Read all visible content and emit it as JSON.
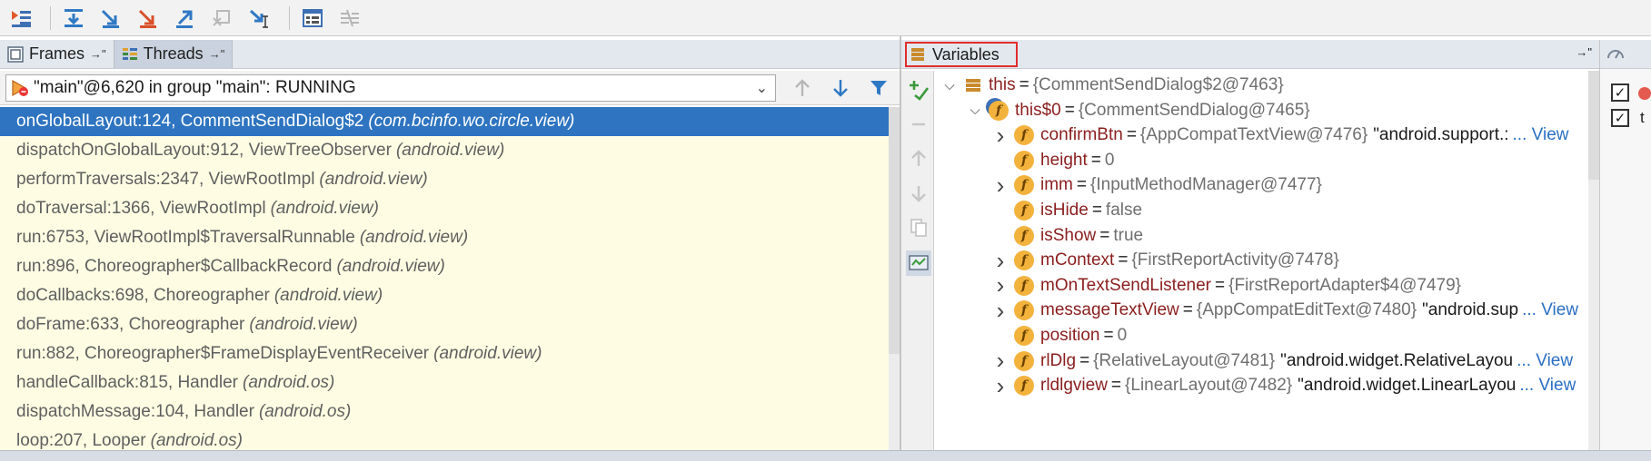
{
  "colors": {
    "selected_row": "#2e74c0",
    "frames_bg": "#fefde3",
    "field_name": "#8b1e1e",
    "type_text": "#6f6f6f",
    "link": "#2a6fc4",
    "highlight_box": "#e22d2d"
  },
  "toolbar": {
    "icons": [
      "show-execution-point-icon",
      "step-over-icon",
      "step-into-icon",
      "force-step-into-icon",
      "step-out-icon",
      "drop-frame-icon",
      "run-to-cursor-icon",
      "evaluate-expression-icon",
      "trace-icon"
    ]
  },
  "left": {
    "tabs": [
      {
        "label": "Frames",
        "pin": "→\""
      },
      {
        "label": "Threads",
        "pin": "→\""
      }
    ],
    "thread_selector": "\"main\"@6,620 in group \"main\": RUNNING",
    "frames": [
      {
        "method": "onGlobalLayout:124, CommentSendDialog$2",
        "pkg": "(com.bcinfo.wo.circle.view)"
      },
      {
        "method": "dispatchOnGlobalLayout:912, ViewTreeObserver",
        "pkg": "(android.view)"
      },
      {
        "method": "performTraversals:2347, ViewRootImpl",
        "pkg": "(android.view)"
      },
      {
        "method": "doTraversal:1366, ViewRootImpl",
        "pkg": "(android.view)"
      },
      {
        "method": "run:6753, ViewRootImpl$TraversalRunnable",
        "pkg": "(android.view)"
      },
      {
        "method": "run:896, Choreographer$CallbackRecord",
        "pkg": "(android.view)"
      },
      {
        "method": "doCallbacks:698, Choreographer",
        "pkg": "(android.view)"
      },
      {
        "method": "doFrame:633, Choreographer",
        "pkg": "(android.view)"
      },
      {
        "method": "run:882, Choreographer$FrameDisplayEventReceiver",
        "pkg": "(android.view)"
      },
      {
        "method": "handleCallback:815, Handler",
        "pkg": "(android.os)"
      },
      {
        "method": "dispatchMessage:104, Handler",
        "pkg": "(android.os)"
      },
      {
        "method": "loop:207, Looper",
        "pkg": "(android.os)"
      }
    ]
  },
  "right": {
    "tab_label": "Variables",
    "pin": "→\"",
    "vars": [
      {
        "name": "this",
        "eq": "=",
        "type": "{CommentSendDialog$2@7463}",
        "str": "",
        "view": ""
      },
      {
        "name": "this$0",
        "eq": "=",
        "type": "{CommentSendDialog@7465}",
        "str": "",
        "view": ""
      },
      {
        "name": "confirmBtn",
        "eq": "=",
        "type": "{AppCompatTextView@7476}",
        "str": "\"android.support.:",
        "view": "... View"
      },
      {
        "name": "height",
        "eq": "=",
        "type": "0",
        "str": "",
        "view": ""
      },
      {
        "name": "imm",
        "eq": "=",
        "type": "{InputMethodManager@7477}",
        "str": "",
        "view": ""
      },
      {
        "name": "isHide",
        "eq": "=",
        "type": "false",
        "str": "",
        "view": ""
      },
      {
        "name": "isShow",
        "eq": "=",
        "type": "true",
        "str": "",
        "view": ""
      },
      {
        "name": "mContext",
        "eq": "=",
        "type": "{FirstReportActivity@7478}",
        "str": "",
        "view": ""
      },
      {
        "name": "mOnTextSendListener",
        "eq": "=",
        "type": "{FirstReportAdapter$4@7479}",
        "str": "",
        "view": ""
      },
      {
        "name": "messageTextView",
        "eq": "=",
        "type": "{AppCompatEditText@7480}",
        "str": "\"android.sup",
        "view": "... View"
      },
      {
        "name": "position",
        "eq": "=",
        "type": "0",
        "str": "",
        "view": ""
      },
      {
        "name": "rlDlg",
        "eq": "=",
        "type": "{RelativeLayout@7481}",
        "str": "\"android.widget.RelativeLayou",
        "view": "... View"
      },
      {
        "name": "rldlgview",
        "eq": "=",
        "type": "{LinearLayout@7482}",
        "str": "\"android.widget.LinearLayou",
        "view": "... View"
      }
    ]
  },
  "watches": {
    "label": "t"
  }
}
